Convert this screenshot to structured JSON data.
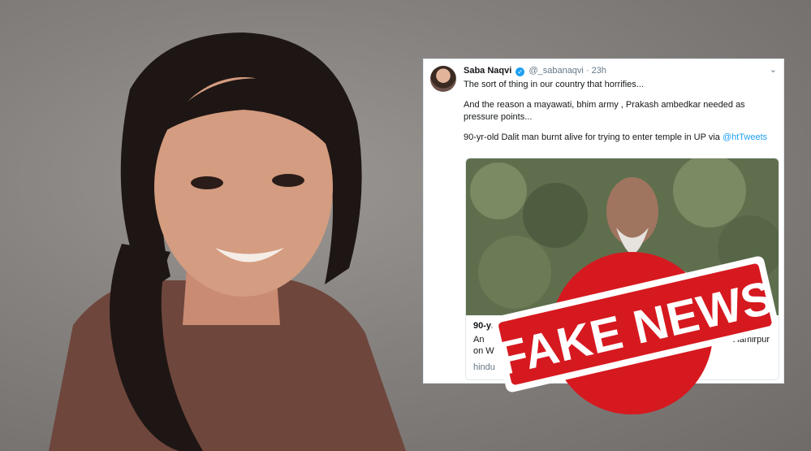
{
  "tweet": {
    "author_name": "Saba Naqvi",
    "handle": "@_sabanaqvi",
    "time": "23h",
    "line1": "The sort of thing in our country that horrifies...",
    "line2": "And the reason a mayawati, bhim army , Prakash ambedkar needed as pressure points...",
    "line3_text": "90-yr-old Dalit man burnt alive for trying to enter temple in UP via ",
    "line3_mention": "@htTweets"
  },
  "card": {
    "title": "90-yr-old D",
    "description_start": "An",
    "description_end": "in Hamirpur",
    "description_line2": "on W",
    "domain": "hindu"
  },
  "stamp": {
    "text": "FAKE NEWS",
    "color": "#d6191f"
  },
  "icons": {
    "verified": "verified-badge-icon",
    "chevron": "chevron-down-icon"
  }
}
